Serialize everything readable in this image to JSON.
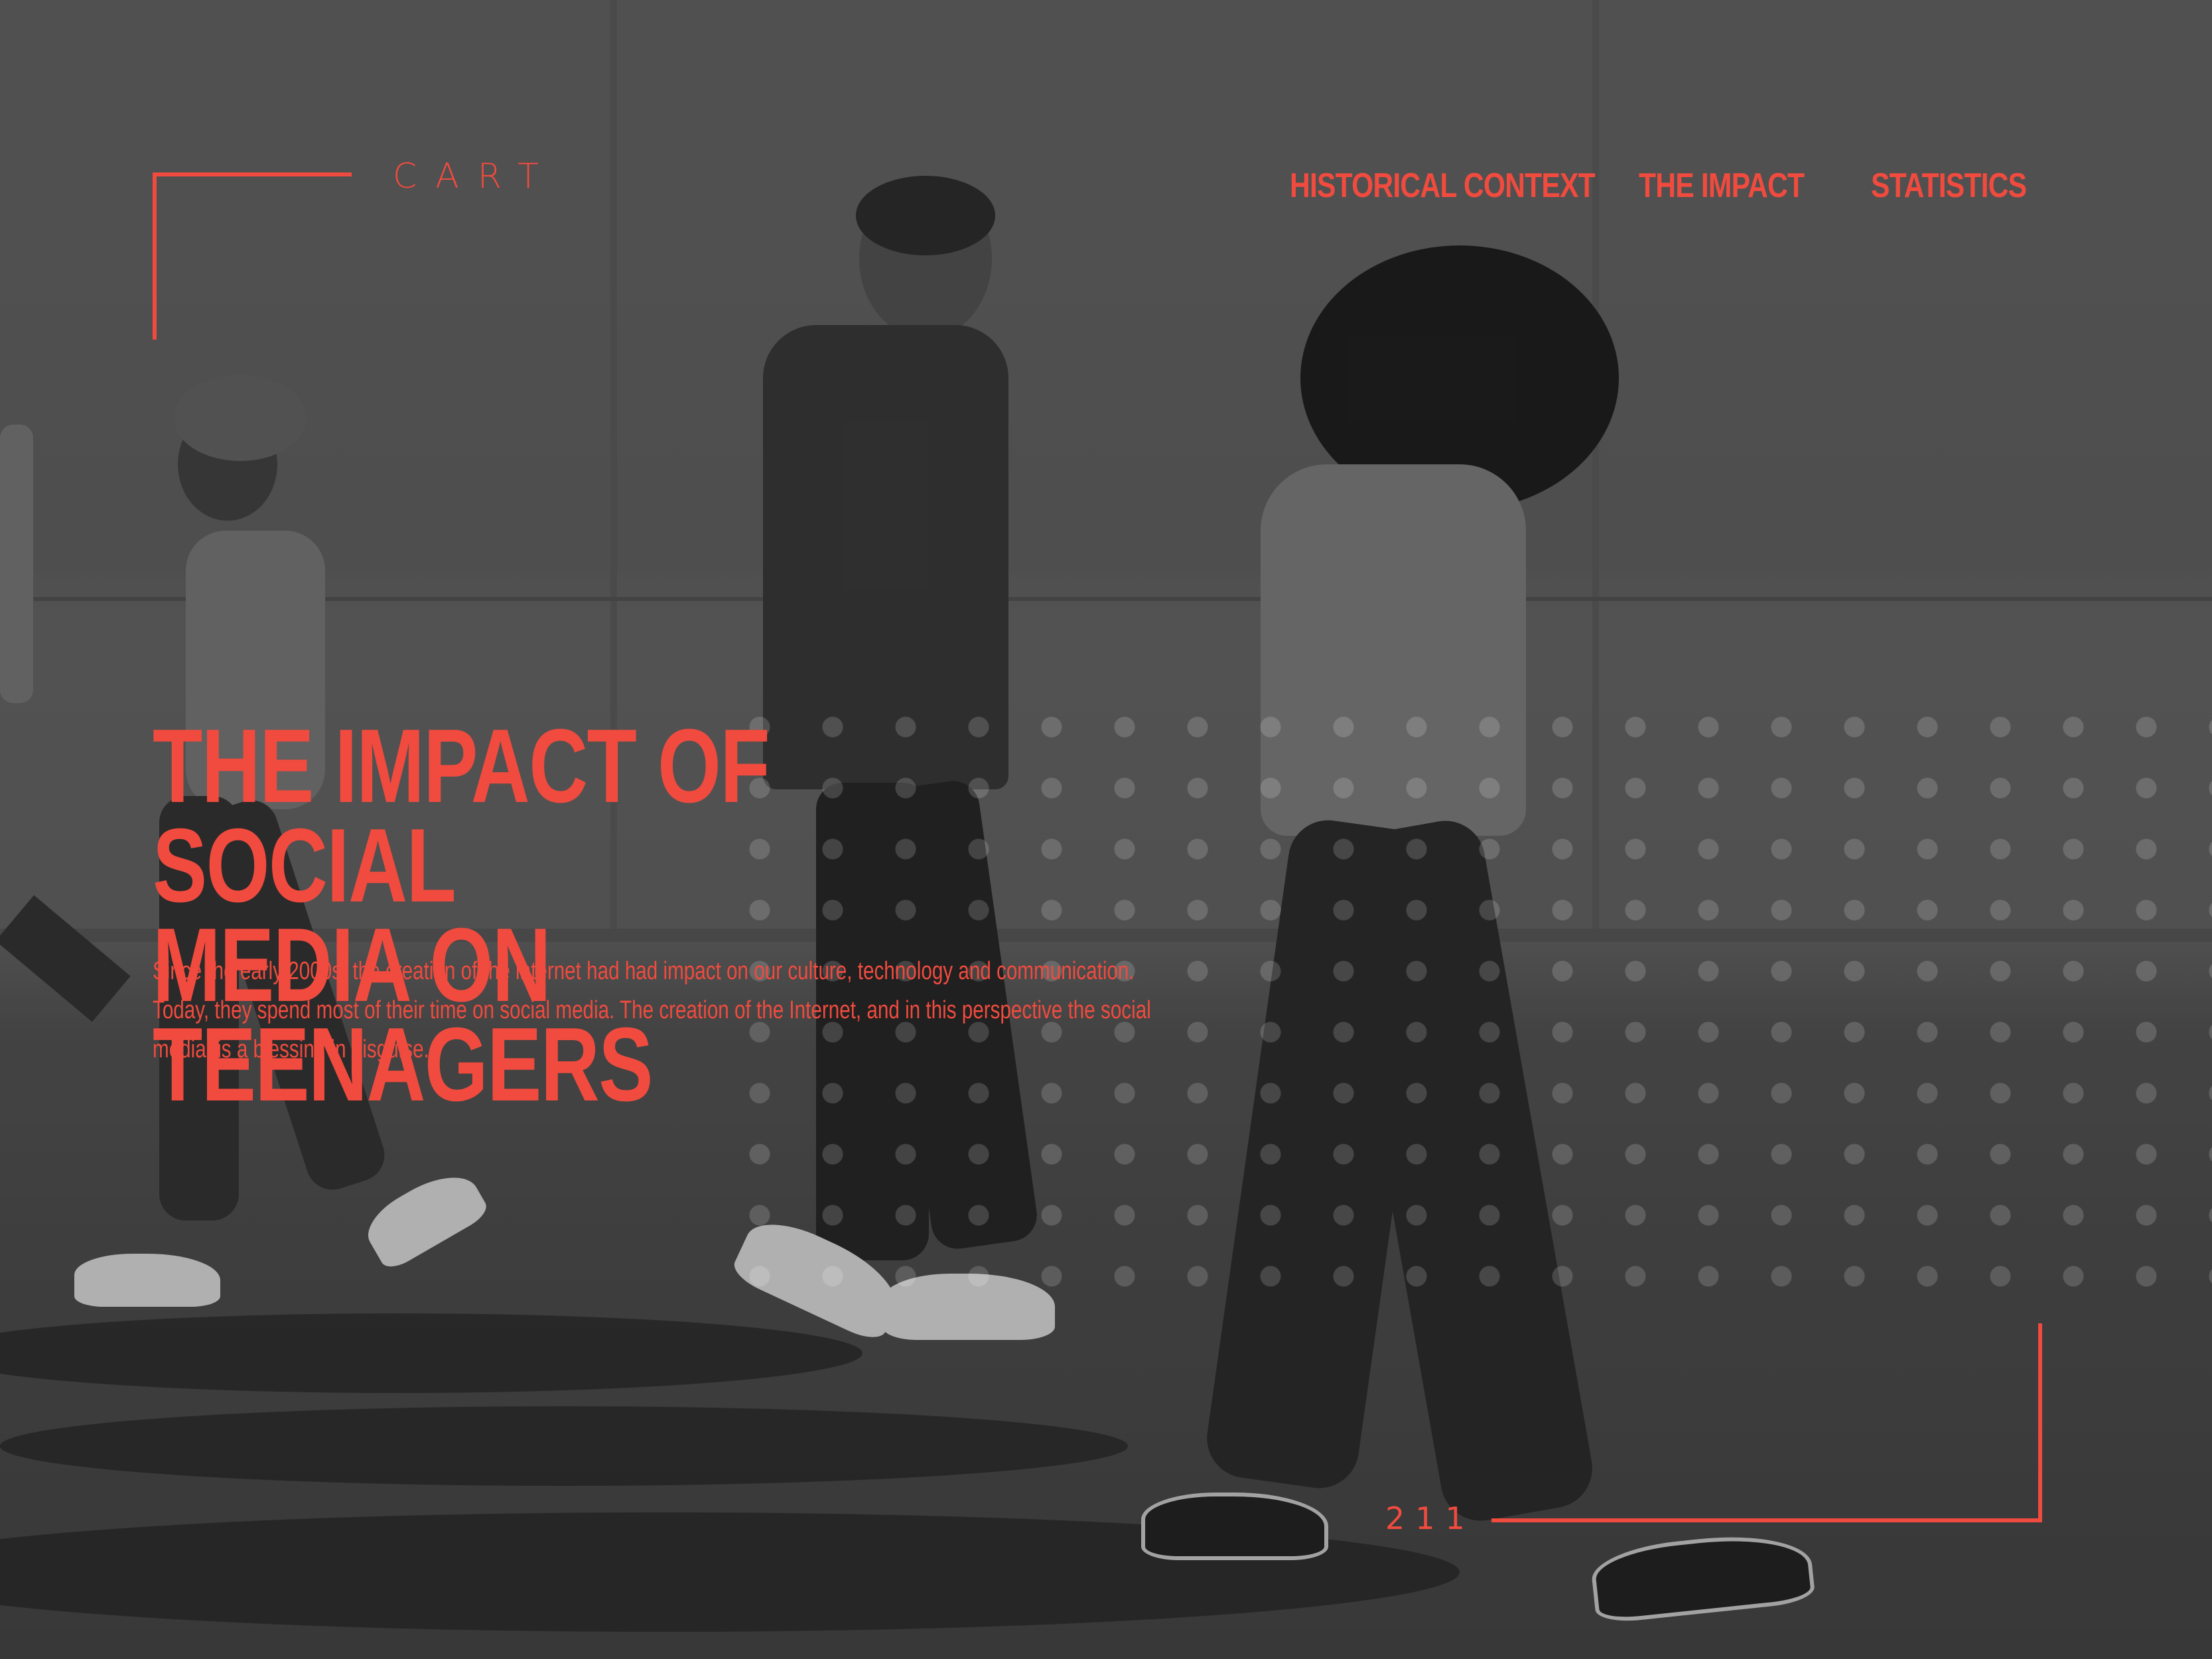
{
  "brand": {
    "label": "CART"
  },
  "nav": {
    "items": [
      {
        "label": "HISTORICAL CONTEXT"
      },
      {
        "label": "THE IMPACT"
      },
      {
        "label": "STATISTICS"
      }
    ]
  },
  "hero": {
    "title_line1": "THE IMPACT OF SOCIAL",
    "title_line2": "MEDIA ON TEENAGERS",
    "description": "Since the early 2000s, the creation of the internet had had impact on our culture, technology and communication. Today, they spend most of their time on social media. The creation of the Internet, and in this perspective the social media, is a blessing in disguise."
  },
  "footer": {
    "page_number": "211"
  },
  "colors": {
    "accent": "#f04b3e",
    "background": "#4f4f4f"
  },
  "icons": {
    "corner_top_left": "corner-bracket-icon",
    "corner_bottom_right": "corner-bracket-icon"
  }
}
